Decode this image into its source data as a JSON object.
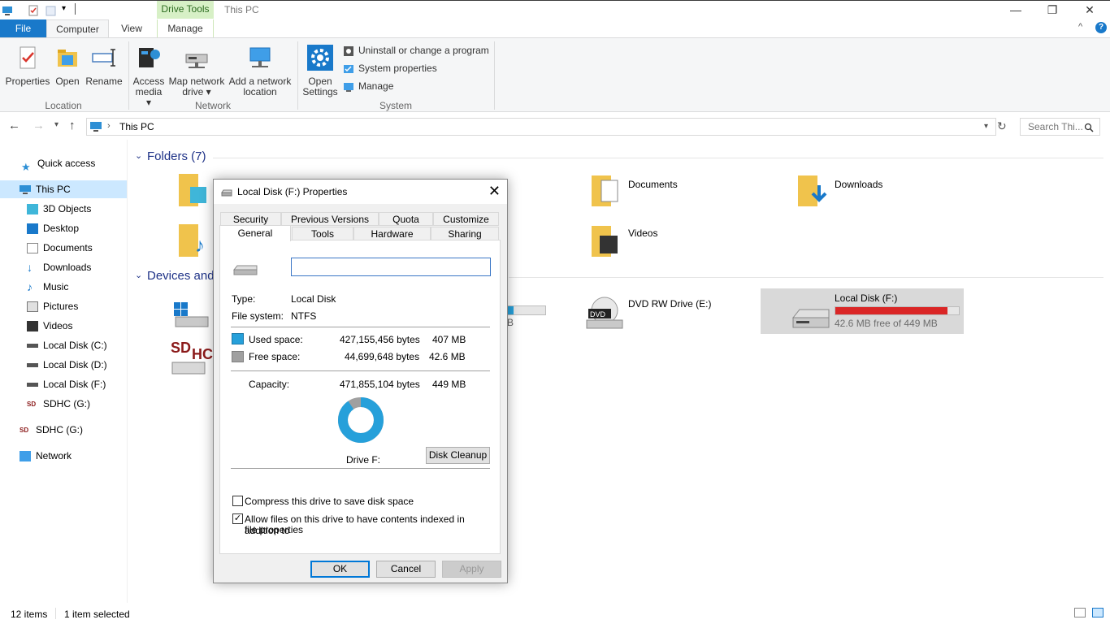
{
  "titlebar": {
    "context_tab": "Drive Tools",
    "title": "This PC",
    "minimize": "—",
    "restore": "❐",
    "close": "✕"
  },
  "ribbon_tabs": {
    "file": "File",
    "computer": "Computer",
    "view": "View",
    "manage": "Manage"
  },
  "ribbon": {
    "location": {
      "label": "Location",
      "properties": "Properties",
      "open": "Open",
      "rename": "Rename"
    },
    "network": {
      "label": "Network",
      "access_media_1": "Access",
      "access_media_2": "media ▾",
      "map_drive_1": "Map network",
      "map_drive_2": "drive ▾",
      "add_location_1": "Add a network",
      "add_location_2": "location"
    },
    "system": {
      "label": "System",
      "open_settings_1": "Open",
      "open_settings_2": "Settings",
      "uninstall": "Uninstall or change a program",
      "system_properties": "System properties",
      "manage": "Manage"
    }
  },
  "address": {
    "path": "This PC",
    "search_placeholder": "Search Thi..."
  },
  "sidebar": {
    "quick_access": "Quick access",
    "this_pc": "This PC",
    "items": [
      "3D Objects",
      "Desktop",
      "Documents",
      "Downloads",
      "Music",
      "Pictures",
      "Videos",
      "Local Disk (C:)",
      "Local Disk (D:)",
      "Local Disk (F:)",
      "SDHC (G:)"
    ],
    "sdhc": "SDHC (G:)",
    "network": "Network"
  },
  "content": {
    "folders_header": "Folders (7)",
    "devices_header": "Devices and",
    "documents": "Documents",
    "downloads": "Downloads",
    "videos": "Videos",
    "dvd": "DVD RW Drive (E:)",
    "local_f": "Local Disk (F:)",
    "local_f_free": "42.6 MB free of 449 MB",
    "local_f_used_fraction": 0.905,
    "partial_label": "B"
  },
  "status": {
    "items": "12 items",
    "selected": "1 item selected"
  },
  "dialog": {
    "title": "Local Disk (F:) Properties",
    "tabs_row1": [
      "Security",
      "Previous Versions",
      "Quota",
      "Customize"
    ],
    "tabs_row2": [
      "General",
      "Tools",
      "Hardware",
      "Sharing"
    ],
    "name_value": "",
    "type_label": "Type:",
    "type_value": "Local Disk",
    "fs_label": "File system:",
    "fs_value": "NTFS",
    "used_label": "Used space:",
    "used_bytes": "427,155,456 bytes",
    "used_size": "407 MB",
    "free_label": "Free space:",
    "free_bytes": "44,699,648 bytes",
    "free_size": "42.6 MB",
    "capacity_label": "Capacity:",
    "capacity_bytes": "471,855,104 bytes",
    "capacity_size": "449 MB",
    "drive_label": "Drive F:",
    "disk_cleanup": "Disk Cleanup",
    "compress_label": "Compress this drive to save disk space",
    "compress_checked": false,
    "index_label_1": "Allow files on this drive to have contents indexed in addition to",
    "index_label_2": "file properties",
    "index_checked": true,
    "ok": "OK",
    "cancel": "Cancel",
    "apply": "Apply",
    "used_color": "#26a0da",
    "free_color": "#a0a0a0"
  }
}
